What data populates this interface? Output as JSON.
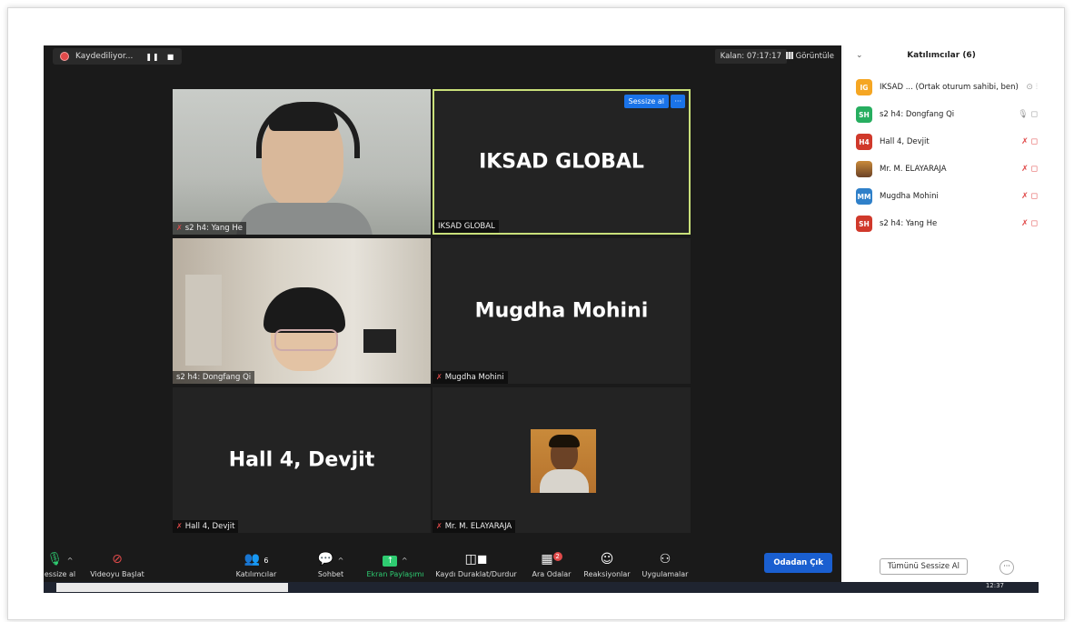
{
  "recording": {
    "label": "Kaydediliyor...",
    "pause_icon": "pause-icon",
    "stop_icon": "stop-icon"
  },
  "header": {
    "remaining": "Kalan: 07:17:17",
    "view_label": "Görüntüle"
  },
  "tiles": [
    {
      "name_label": "s2 h4: Yang He",
      "type": "video",
      "mic": "muted"
    },
    {
      "name_label": "IKSAD GLOBAL",
      "center_name": "IKSAD GLOBAL",
      "active": true,
      "mute_btn": "Sessize al",
      "more_btn": "···"
    },
    {
      "name_label": "s2 h4: Dongfang Qi",
      "type": "video"
    },
    {
      "name_label": "Mugdha Mohini",
      "center_name": "Mugdha Mohini",
      "mic": "muted"
    },
    {
      "name_label": "Hall 4, Devjit",
      "center_name": "Hall 4, Devjit",
      "mic": "muted"
    },
    {
      "name_label": "Mr. M. ELAYARAJA",
      "type": "profile-photo",
      "mic": "muted"
    }
  ],
  "toolbar": {
    "mute": "essize al",
    "video": "Videoyu Başlat",
    "participants": "Katılımcılar",
    "participants_count": "6",
    "chat": "Sohbet",
    "share": "Ekran Paylaşımı",
    "record": "Kaydı Duraklat/Durdur",
    "breakout": "Ara Odalar",
    "breakout_badge": "2",
    "reactions": "Reaksiyonlar",
    "apps": "Uygulamalar",
    "leave": "Odadan Çık",
    "share_color": "#2ecc71"
  },
  "panel": {
    "title": "Katılımcılar (6)",
    "participants": [
      {
        "initials": "IG",
        "color": "#f5a623",
        "name": "IKSAD ...  (Ortak oturum sahibi, ben)",
        "icons": "⊙ ⫶",
        "muted": false
      },
      {
        "initials": "SH",
        "color": "#27ae60",
        "name": "s2 h4: Dongfang Qi",
        "icons": "🎙 ◻",
        "muted": false
      },
      {
        "initials": "H4",
        "color": "#d0392b",
        "name": "Hall 4, Devjit",
        "icons": "✗ ◻",
        "muted": true
      },
      {
        "initials": "",
        "color": "#8b5a2b",
        "name": "Mr. M. ELAYARAJA",
        "icons": "✗ ◻",
        "muted": true,
        "photo": true
      },
      {
        "initials": "MM",
        "color": "#2f80c9",
        "name": "Mugdha Mohini",
        "icons": "✗ ◻",
        "muted": true
      },
      {
        "initials": "SH",
        "color": "#d0392b",
        "name": "s2 h4: Yang He",
        "icons": "✗ ◻",
        "muted": true
      }
    ],
    "mute_all": "Tümünü Sessize Al",
    "more": "···"
  },
  "taskbar": {
    "clock": "12:37"
  }
}
